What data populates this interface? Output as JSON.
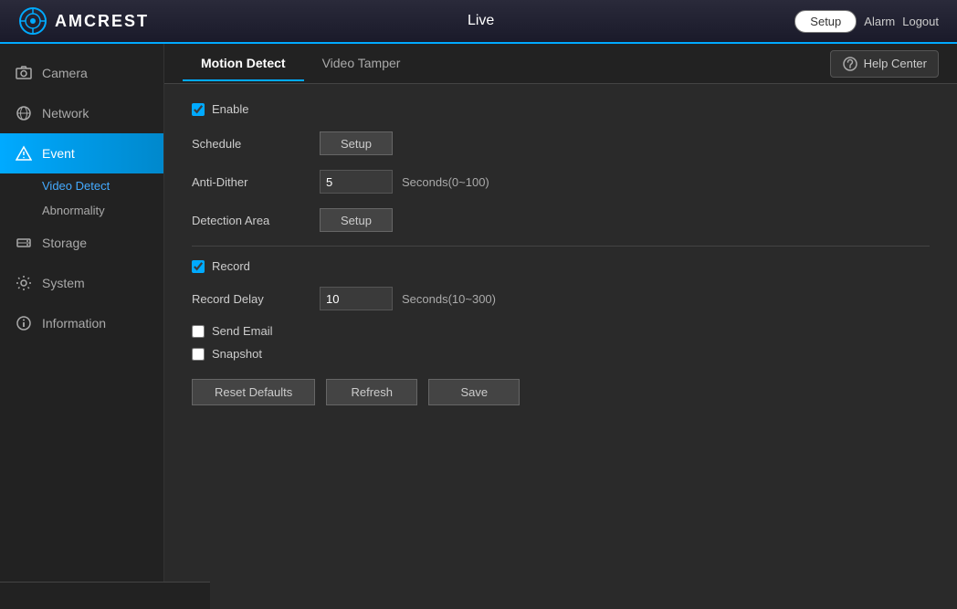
{
  "header": {
    "logo_text": "AMCREST",
    "live_label": "Live",
    "setup_label": "Setup",
    "alarm_label": "Alarm",
    "logout_label": "Logout"
  },
  "sidebar": {
    "items": [
      {
        "id": "camera",
        "label": "Camera",
        "icon": "camera-icon"
      },
      {
        "id": "network",
        "label": "Network",
        "icon": "network-icon"
      },
      {
        "id": "event",
        "label": "Event",
        "icon": "event-icon",
        "active": true
      },
      {
        "id": "storage",
        "label": "Storage",
        "icon": "storage-icon"
      },
      {
        "id": "system",
        "label": "System",
        "icon": "system-icon"
      },
      {
        "id": "information",
        "label": "Information",
        "icon": "info-icon"
      }
    ],
    "sub_items": [
      {
        "id": "video-detect",
        "label": "Video Detect",
        "active": true
      },
      {
        "id": "abnormality",
        "label": "Abnormality",
        "active": false
      }
    ]
  },
  "tabs": [
    {
      "id": "motion-detect",
      "label": "Motion Detect",
      "active": true
    },
    {
      "id": "video-tamper",
      "label": "Video Tamper",
      "active": false
    }
  ],
  "help_center_label": "Help Center",
  "form": {
    "enable_label": "Enable",
    "enable_checked": true,
    "schedule_label": "Schedule",
    "schedule_btn": "Setup",
    "anti_dither_label": "Anti-Dither",
    "anti_dither_value": "5",
    "anti_dither_hint": "Seconds(0~100)",
    "detection_area_label": "Detection Area",
    "detection_area_btn": "Setup",
    "record_label": "Record",
    "record_checked": true,
    "record_delay_label": "Record Delay",
    "record_delay_value": "10",
    "record_delay_hint": "Seconds(10~300)",
    "send_email_label": "Send Email",
    "send_email_checked": false,
    "snapshot_label": "Snapshot",
    "snapshot_checked": false
  },
  "buttons": {
    "reset_defaults": "Reset Defaults",
    "refresh": "Refresh",
    "save": "Save"
  }
}
